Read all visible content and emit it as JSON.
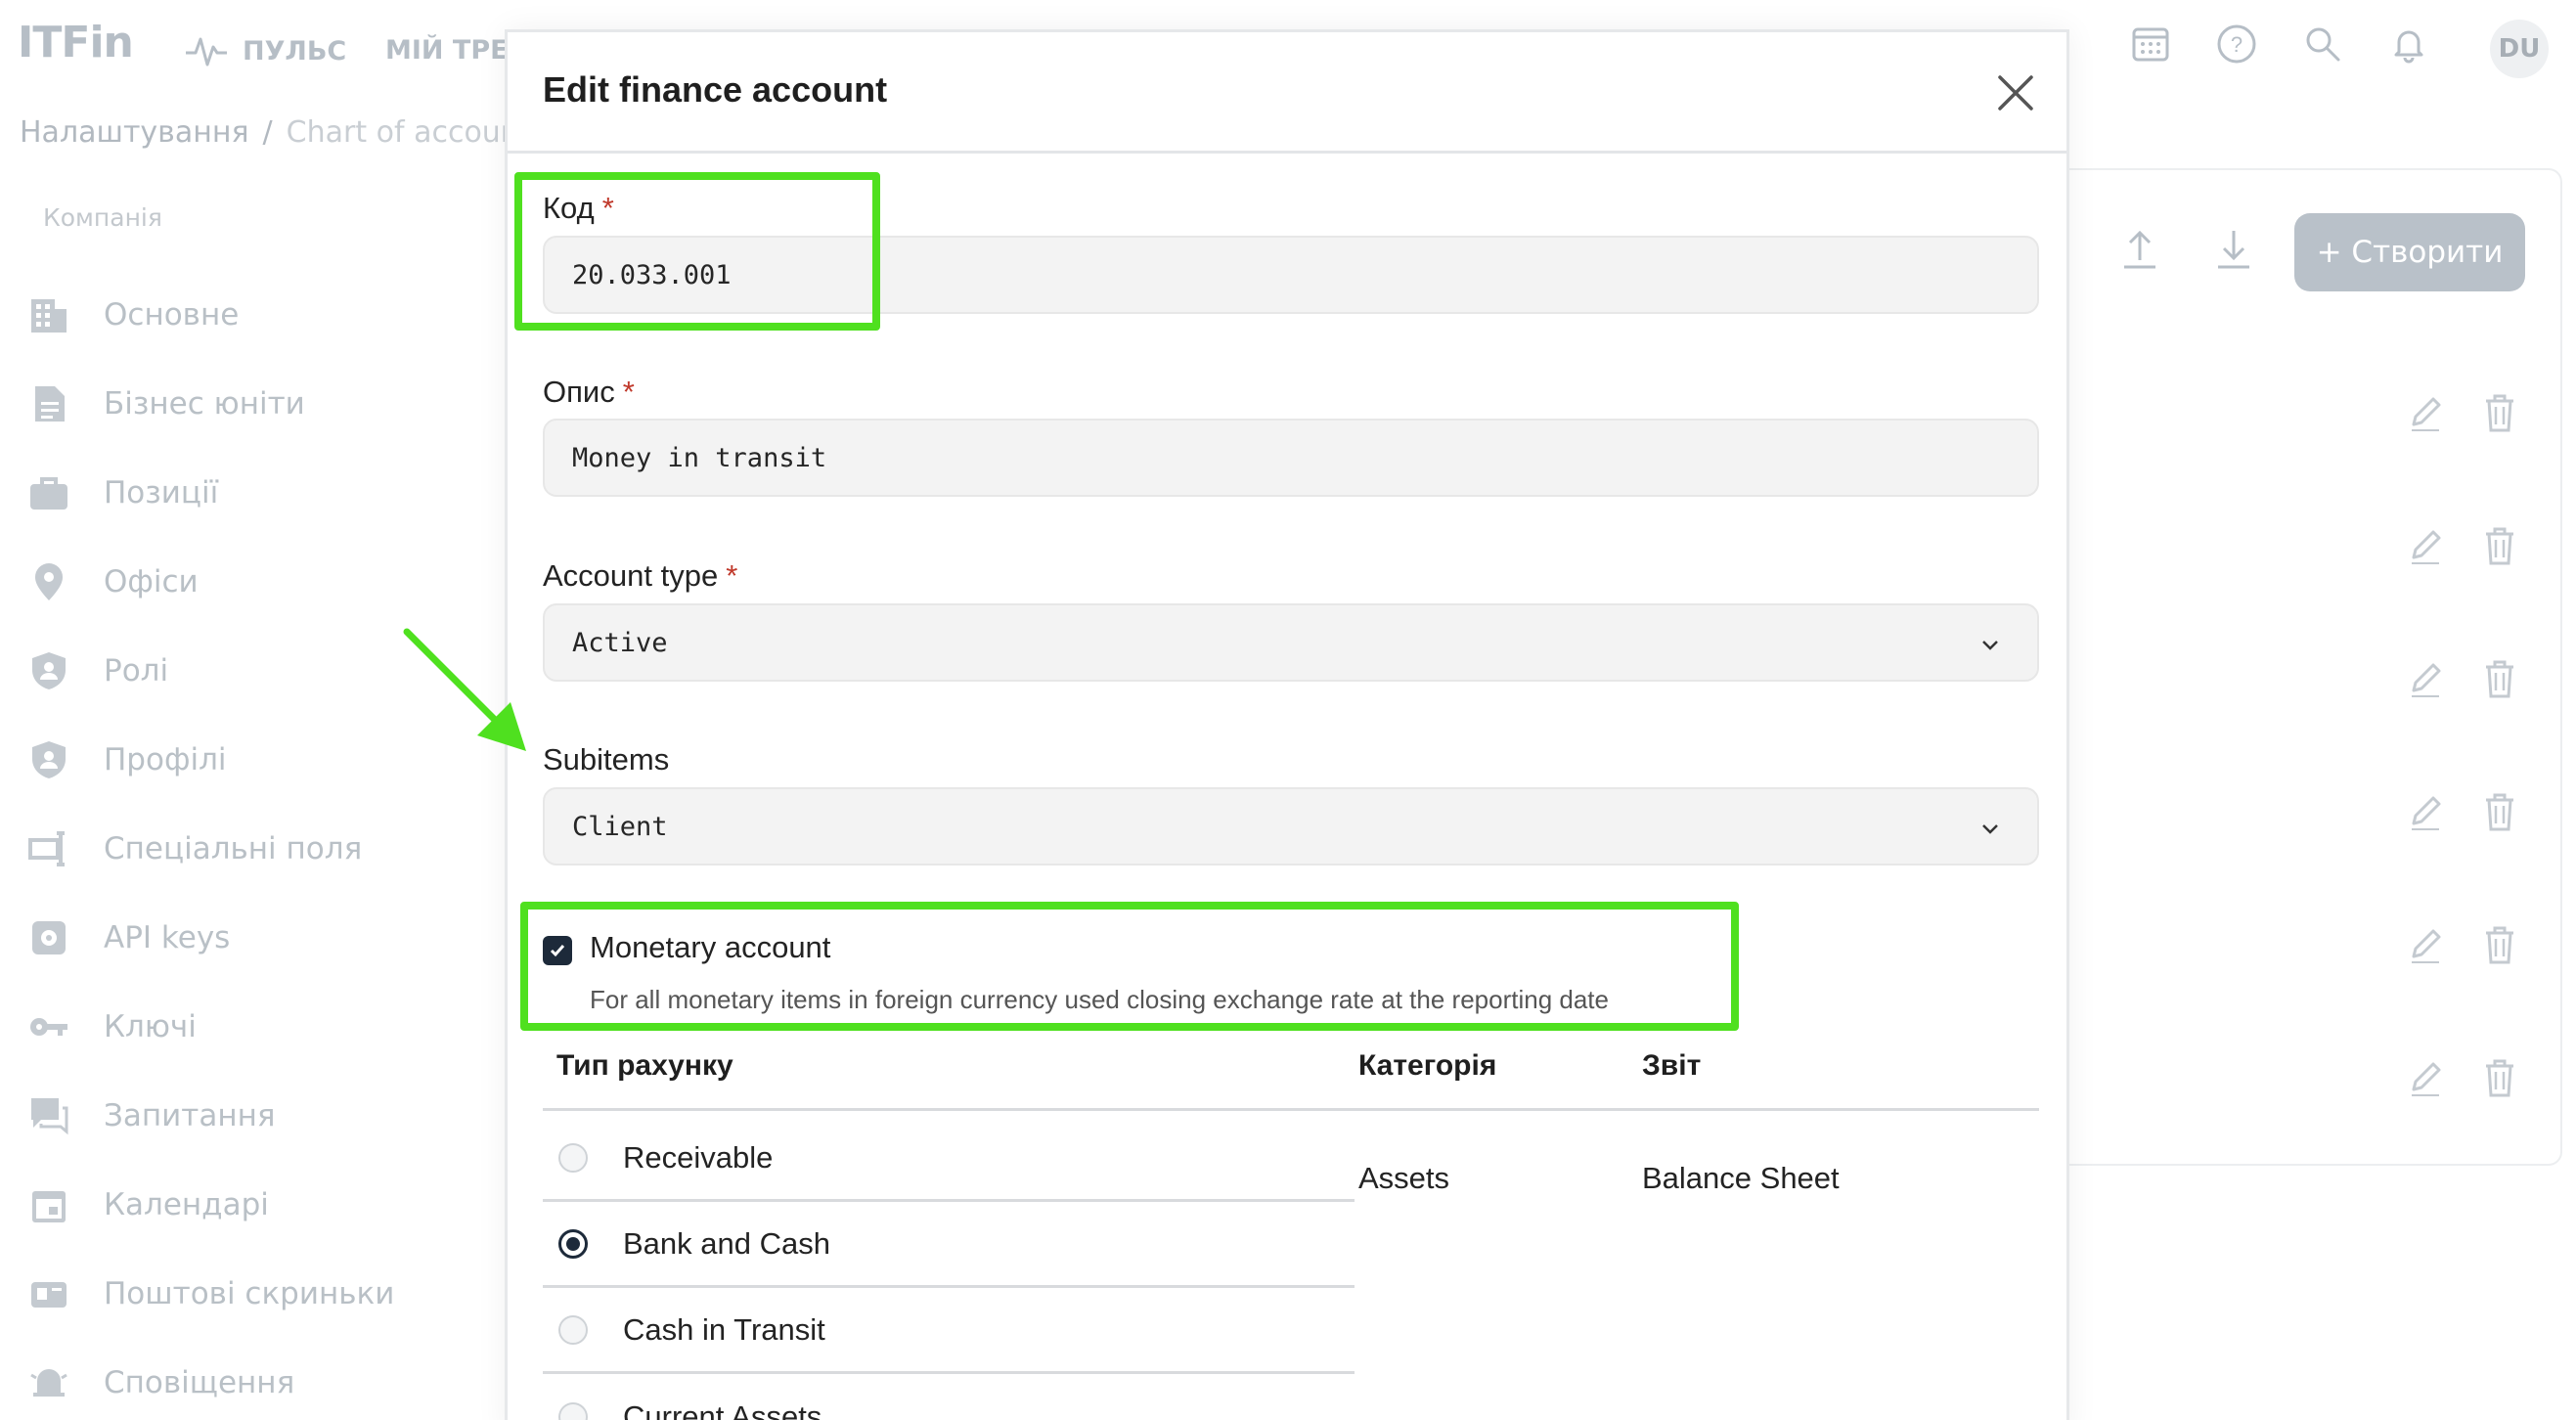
{
  "app": {
    "logo": "ITFin",
    "nav": {
      "pulse": "ПУЛЬС",
      "tracker": "МІЙ ТРЕКЕ"
    },
    "avatar_initials": "DU"
  },
  "breadcrumb": {
    "root": "Налаштування",
    "separator": "/",
    "current": "Chart of accoun"
  },
  "sidebar": {
    "section": "Компанія",
    "items": [
      {
        "label": "Основне",
        "icon": "building-icon"
      },
      {
        "label": "Бізнес юніти",
        "icon": "document-icon"
      },
      {
        "label": "Позиції",
        "icon": "briefcase-icon"
      },
      {
        "label": "Офіси",
        "icon": "map-pin-icon"
      },
      {
        "label": "Ролі",
        "icon": "shield-user-icon"
      },
      {
        "label": "Профілі",
        "icon": "shield-user-icon"
      },
      {
        "label": "Спеціальні поля",
        "icon": "custom-field-icon"
      },
      {
        "label": "API keys",
        "icon": "api-chip-icon"
      },
      {
        "label": "Ключі",
        "icon": "key-icon"
      },
      {
        "label": "Запитання",
        "icon": "question-chat-icon"
      },
      {
        "label": "Календарі",
        "icon": "calendar-icon"
      },
      {
        "label": "Поштові скриньки",
        "icon": "mailbox-icon"
      },
      {
        "label": "Сповіщення",
        "icon": "bell-alert-icon"
      }
    ]
  },
  "toolbar": {
    "create_label": "+ Створити"
  },
  "modal": {
    "title": "Edit finance account",
    "code": {
      "label": "Код",
      "required": "*",
      "value": "20.033.001"
    },
    "description": {
      "label": "Опис",
      "required": "*",
      "value": "Money in transit"
    },
    "account_type": {
      "label": "Account type",
      "required": "*",
      "value": "Active"
    },
    "subitems": {
      "label": "Subitems",
      "value": "Client"
    },
    "monetary": {
      "checked": true,
      "label": "Monetary account",
      "hint": "For all monetary items in foreign currency used closing exchange rate at the reporting date"
    },
    "table": {
      "headers": [
        "Тип рахунку",
        "Категорія",
        "Звіт"
      ],
      "rows": [
        {
          "label": "Receivable",
          "selected": false
        },
        {
          "label": "Bank and Cash",
          "selected": true
        },
        {
          "label": "Cash in Transit",
          "selected": false
        },
        {
          "label": "Current Assets",
          "selected": false
        }
      ],
      "category": "Assets",
      "report": "Balance Sheet"
    }
  },
  "colors": {
    "highlight": "#4fe01f",
    "accent_dark": "#1d2a3a",
    "required": "#c0392b",
    "muted": "#b9c0c6"
  }
}
